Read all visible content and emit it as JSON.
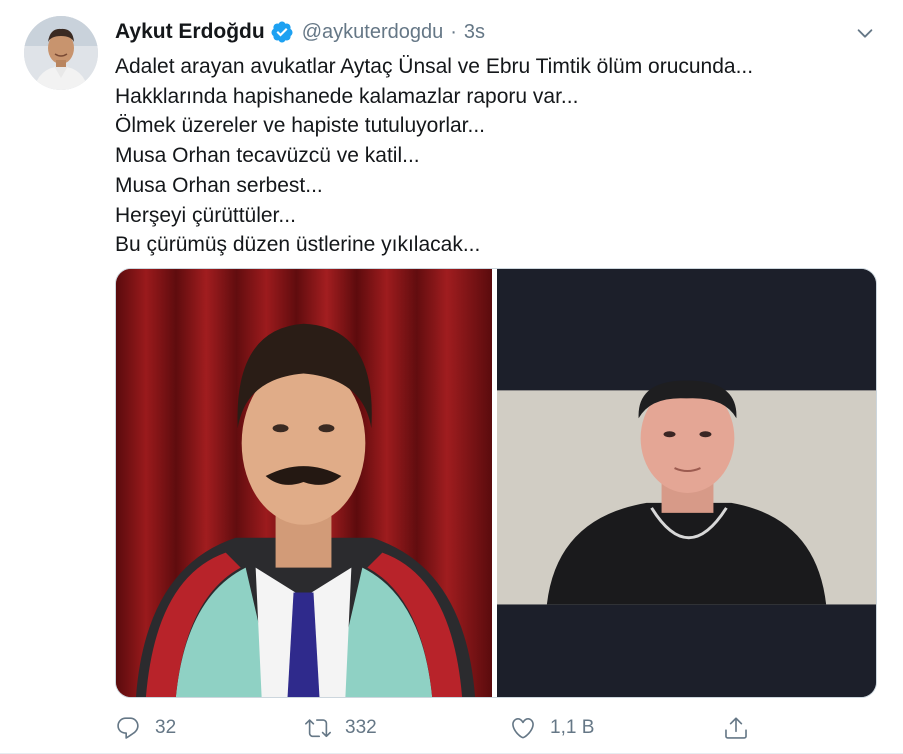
{
  "tweet": {
    "author_name": "Aykut Erdoğdu",
    "handle": "@aykuterdogdu",
    "separator": "·",
    "time": "3s",
    "lines": [
      "Adalet arayan avukatlar Aytaç Ünsal ve Ebru Timtik ölüm orucunda...",
      "Hakklarında hapishanede kalamazlar raporu var...",
      "Ölmek üzereler ve hapiste tutuluyorlar...",
      "Musa Orhan tecavüzcü ve katil...",
      "Musa Orhan serbest...",
      "Herşeyi çürüttüler...",
      "Bu çürümüş düzen üstlerine yıkılacak..."
    ],
    "media": [
      "lawyer-portrait-photo",
      "man-portrait-photo"
    ]
  },
  "actions": {
    "reply_count": "32",
    "retweet_count": "332",
    "like_count": "1,1 B"
  },
  "icons": {
    "verified": "verified-badge-icon",
    "caret": "chevron-down-icon",
    "reply": "reply-icon",
    "retweet": "retweet-icon",
    "like": "heart-icon",
    "share": "share-icon"
  },
  "colors": {
    "accent": "#1da1f2",
    "text": "#14171a",
    "secondary": "#657786",
    "border": "#e6ecf0"
  }
}
